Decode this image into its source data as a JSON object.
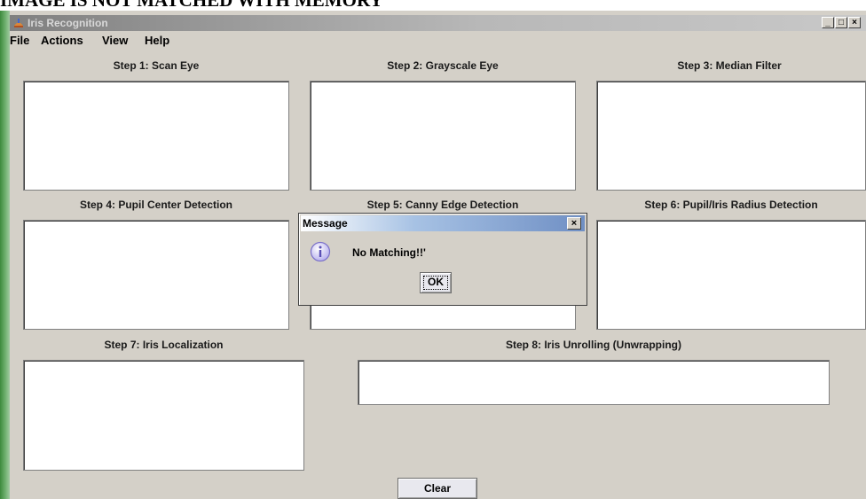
{
  "caption": "IMAGE IS NOT MATCHED WITH MEMORY",
  "window": {
    "title": "Iris Recognition",
    "controls": {
      "minimize": "_",
      "maximize": "□",
      "close": "×"
    }
  },
  "menu": [
    "File",
    "Actions",
    "View",
    "Help"
  ],
  "steps": [
    "Step 1: Scan Eye",
    "Step 2: Grayscale Eye",
    "Step 3: Median Filter",
    "Step 4: Pupil Center Detection",
    "Step 5: Canny Edge Detection",
    "Step 6: Pupil/Iris Radius Detection",
    "Step 7: Iris Localization",
    "Step 8: Iris Unrolling (Unwrapping)"
  ],
  "dialog": {
    "title": "Message",
    "close": "×",
    "message": "No Matching!!'",
    "ok_label": "OK",
    "icon": "info-icon"
  },
  "clear_label": "Clear",
  "colors": {
    "window_bg": "#d4d0c8",
    "panel_bg": "#ffffff",
    "dialog_title_gradient_end": "#6f8fc4",
    "info_icon": "#8a7fd6"
  }
}
